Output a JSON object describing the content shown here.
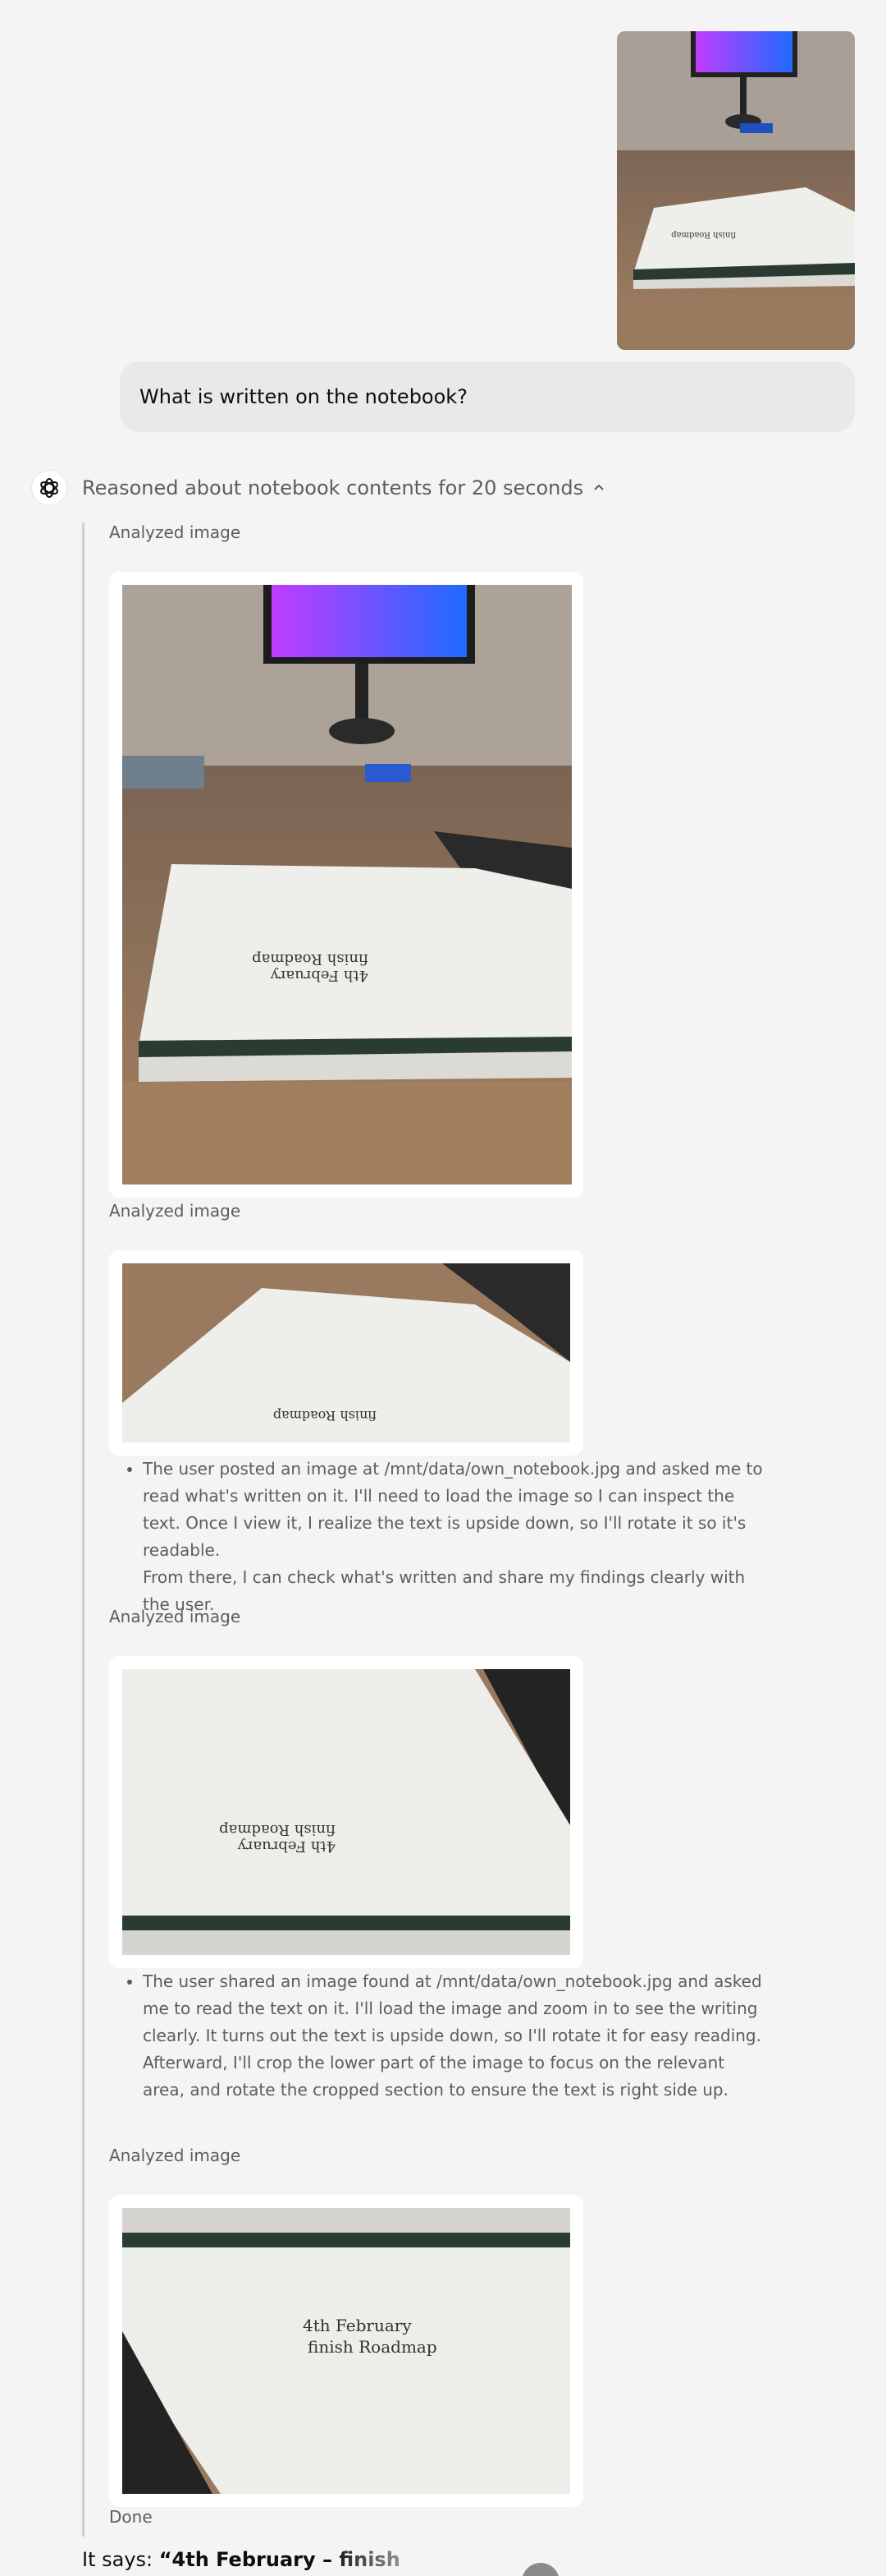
{
  "user": {
    "question": "What is written on the notebook?"
  },
  "assistant": {
    "reasoning_header": "Reasoned about notebook contents for 20 seconds",
    "steps": [
      {
        "label": "Analyzed image"
      },
      {
        "label": "Analyzed image",
        "text": "The user posted an image at /mnt/data/own_notebook.jpg and asked me to read what's written on it. I'll need to load the image so I can inspect the text. Once I view it, I realize the text is upside down, so I'll rotate it so it's readable.",
        "text2": "From there, I can check what's written and share my findings clearly with the user."
      },
      {
        "label": "Analyzed image",
        "text": "The user shared an image found at /mnt/data/own_notebook.jpg and asked me to read the text on it. I'll load the image and zoom in to see the writing clearly. It turns out the text is upside down, so I'll rotate it for easy reading. Afterward, I'll crop the lower part of the image to focus on the relevant area, and rotate the cropped section to ensure the text is right side up."
      },
      {
        "label": "Analyzed image"
      }
    ],
    "done_label": "Done",
    "answer_prefix": "It says: ",
    "answer_bold": "“4th February – finish"
  },
  "notebook": {
    "line1": "4th February",
    "line2": "finish Roadmap"
  },
  "colors": {
    "page_bg": "#f4f4f4",
    "bubble_bg": "#e9e9e9",
    "muted_text": "#5d5d5d",
    "screen_gradient_start": "#c13cff",
    "screen_gradient_end": "#1e6bff",
    "table_wood": "#9a7a5e"
  }
}
